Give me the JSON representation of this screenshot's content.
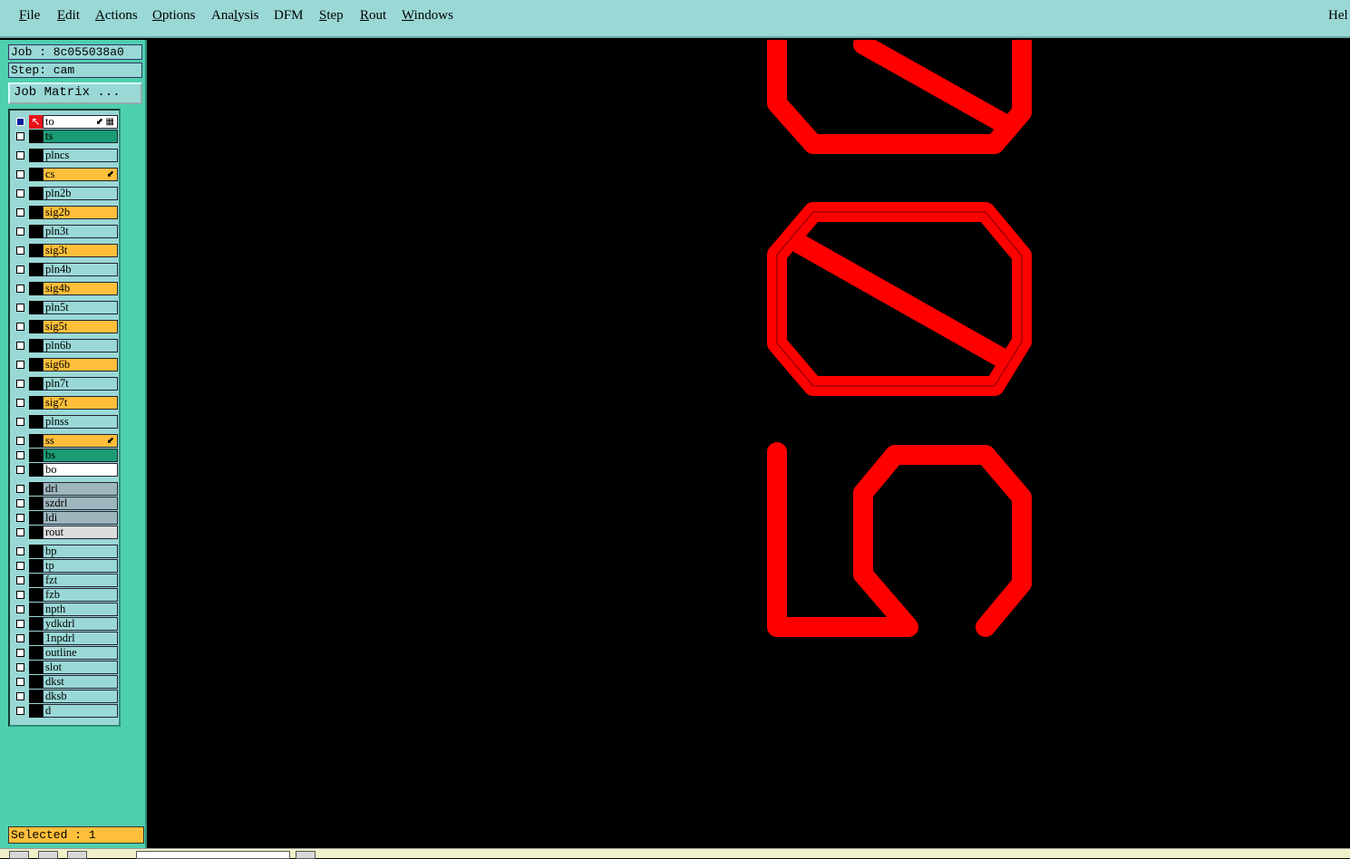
{
  "menubar": {
    "items": [
      {
        "pre": "",
        "mn": "F",
        "post": "ile"
      },
      {
        "pre": "",
        "mn": "E",
        "post": "dit"
      },
      {
        "pre": "",
        "mn": "A",
        "post": "ctions"
      },
      {
        "pre": "",
        "mn": "O",
        "post": "ptions"
      },
      {
        "pre": "Ana",
        "mn": "l",
        "post": "ysis"
      },
      {
        "pre": "DFM",
        "mn": "",
        "post": ""
      },
      {
        "pre": "",
        "mn": "S",
        "post": "tep"
      },
      {
        "pre": "",
        "mn": "R",
        "post": "out"
      },
      {
        "pre": "",
        "mn": "W",
        "post": "indows"
      }
    ],
    "help_label": "Hel"
  },
  "left_panel": {
    "job": "Job : 8c055038a0",
    "step": "Step: cam",
    "job_matrix_label": "Job Matrix ...",
    "selected": "Selected : 1"
  },
  "layers": [
    {
      "name": "to",
      "color": "white",
      "checked": true,
      "active": true,
      "marks": "⬋ ▦"
    },
    {
      "name": "ts",
      "color": "green"
    },
    {
      "name": "plncs",
      "color": "cyan"
    },
    {
      "name": "cs",
      "color": "orange",
      "marks": "⬋"
    },
    {
      "name": "pln2b",
      "color": "cyan"
    },
    {
      "name": "sig2b",
      "color": "orange"
    },
    {
      "name": "pln3t",
      "color": "cyan"
    },
    {
      "name": "sig3t",
      "color": "orange"
    },
    {
      "name": "pln4b",
      "color": "cyan"
    },
    {
      "name": "sig4b",
      "color": "orange"
    },
    {
      "name": "pln5t",
      "color": "cyan"
    },
    {
      "name": "sig5t",
      "color": "orange"
    },
    {
      "name": "pln6b",
      "color": "cyan"
    },
    {
      "name": "sig6b",
      "color": "orange"
    },
    {
      "name": "pln7t",
      "color": "cyan"
    },
    {
      "name": "sig7t",
      "color": "orange"
    },
    {
      "name": "plnss",
      "color": "cyan"
    },
    {
      "name": "ss",
      "color": "orange",
      "marks": "⬋"
    },
    {
      "name": "bs",
      "color": "green"
    },
    {
      "name": "bo",
      "color": "white"
    },
    {
      "name": "drl",
      "color": "slate"
    },
    {
      "name": "szdrl",
      "color": "slate"
    },
    {
      "name": "ldi",
      "color": "slate"
    },
    {
      "name": "rout",
      "color": "light"
    },
    {
      "name": "bp",
      "color": "cyan"
    },
    {
      "name": "tp",
      "color": "cyan"
    },
    {
      "name": "fzt",
      "color": "cyan"
    },
    {
      "name": "fzb",
      "color": "cyan"
    },
    {
      "name": "npth",
      "color": "cyan"
    },
    {
      "name": "ydkdrl",
      "color": "cyan"
    },
    {
      "name": "1npdrl",
      "color": "cyan"
    },
    {
      "name": "outline",
      "color": "cyan"
    },
    {
      "name": "slot",
      "color": "cyan"
    },
    {
      "name": "dkst",
      "color": "cyan"
    },
    {
      "name": "dksb",
      "color": "cyan"
    },
    {
      "name": "d",
      "color": "cyan"
    }
  ],
  "canvas": {
    "text": "502"
  }
}
